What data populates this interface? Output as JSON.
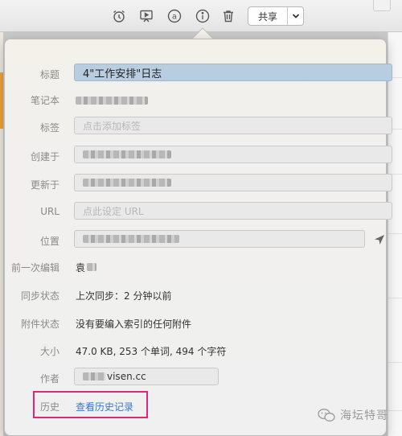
{
  "toolbar": {
    "icons": [
      "alarm-clock-icon",
      "presentation-icon",
      "at-sign-icon",
      "info-icon",
      "trash-icon"
    ],
    "share_label": "共享"
  },
  "note_info": {
    "title_label": "标题",
    "title_value": "4\"工作安排\"日志",
    "notebook_label": "笔记本",
    "tags_label": "标签",
    "tags_placeholder": "点击添加标签",
    "created_label": "创建于",
    "updated_label": "更新于",
    "url_label": "URL",
    "url_placeholder": "点此设定 URL",
    "location_label": "位置",
    "last_editor_label": "前一次编辑",
    "last_editor_value": "袁",
    "sync_label": "同步状态",
    "sync_value": "上次同步：2 分钟以前",
    "attachments_label": "附件状态",
    "attachments_value": "没有要编入索引的任何附件",
    "size_label": "大小",
    "size_value": "47.0 KB, 253 个单词, 494 个字符",
    "author_label": "作者",
    "author_value": "visen.cc",
    "history_label": "历史",
    "history_link": "查看历史记录"
  },
  "watermark": {
    "text": "海坛特哥"
  },
  "colors": {
    "highlight_box": "#e0257a",
    "link": "#3a77c4",
    "title_selection": "#b9cde0",
    "sidebar_accent": "#f0a23a"
  }
}
